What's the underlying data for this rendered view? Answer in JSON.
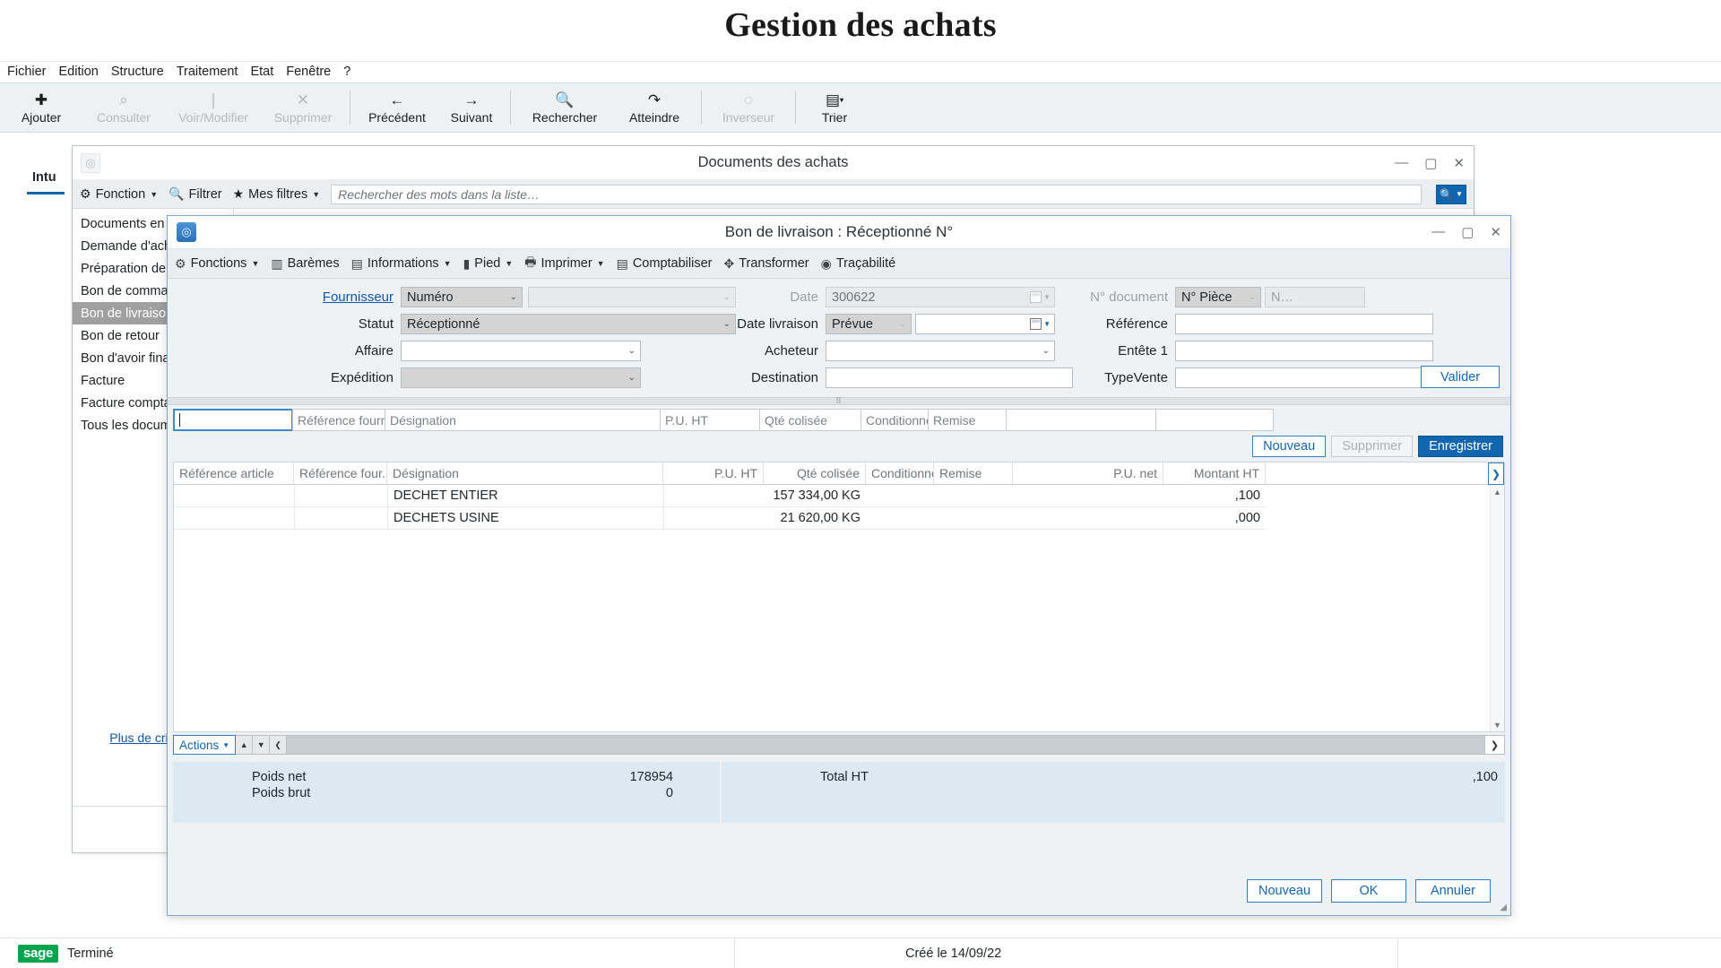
{
  "page": {
    "title": "Gestion des achats"
  },
  "menubar": {
    "items": [
      "Fichier",
      "Edition",
      "Structure",
      "Traitement",
      "Etat",
      "Fenêtre",
      "?"
    ]
  },
  "toolbar": {
    "buttons": [
      {
        "label": "Ajouter",
        "icon": "plus-icon",
        "glyph": "✚",
        "enabled": true
      },
      {
        "label": "Consulter",
        "icon": "magnifier-icon",
        "glyph": "⌕",
        "enabled": false
      },
      {
        "label": "Voir/Modifier",
        "icon": "pencil-icon",
        "glyph": "/",
        "enabled": false
      },
      {
        "label": "Supprimer",
        "icon": "cross-icon",
        "glyph": "✕",
        "enabled": false
      },
      {
        "label": "Précédent",
        "icon": "arrow-left-icon",
        "glyph": "←",
        "enabled": true
      },
      {
        "label": "Suivant",
        "icon": "arrow-right-icon",
        "glyph": "→",
        "enabled": true
      },
      {
        "label": "Rechercher",
        "icon": "search-icon",
        "glyph": "🔍",
        "enabled": true
      },
      {
        "label": "Atteindre",
        "icon": "goto-arrow-icon",
        "glyph": "⌒",
        "enabled": true
      },
      {
        "label": "Inverseur",
        "icon": "refresh-icon",
        "glyph": "◌",
        "enabled": false
      },
      {
        "label": "Trier",
        "icon": "sort-icon",
        "glyph": "▤",
        "enabled": true
      }
    ]
  },
  "background": {
    "side_label": "Intu"
  },
  "outer_window": {
    "title": "Documents des achats",
    "window_buttons": {
      "minimize": "—",
      "maximize": "▢",
      "close": "✕"
    },
    "filterbar": {
      "fonction_label": "Fonction",
      "filtrer_label": "Filtrer",
      "mesfiltres_label": "Mes filtres",
      "search_placeholder": "Rechercher des mots dans la liste…",
      "search_value": ""
    },
    "nav_items": [
      {
        "label": "Documents en cours",
        "selected": false
      },
      {
        "label": "Demande d'achat",
        "selected": false
      },
      {
        "label": "Préparation de commande",
        "selected": false
      },
      {
        "label": "Bon de commande",
        "selected": false
      },
      {
        "label": "Bon de livraison",
        "selected": true
      },
      {
        "label": "Bon de retour",
        "selected": false
      },
      {
        "label": "Bon d'avoir financier",
        "selected": false
      },
      {
        "label": "Facture",
        "selected": false
      },
      {
        "label": "Facture comptabilisée",
        "selected": false
      },
      {
        "label": "Tous les documents",
        "selected": false
      }
    ],
    "more_link": "Plus de critères"
  },
  "dialog": {
    "title": "Bon de livraison : Réceptionné N°",
    "window_buttons": {
      "minimize": "—",
      "maximize": "▢",
      "close": "✕"
    },
    "toolbar": [
      {
        "label": "Fonctions",
        "icon": "gear-icon",
        "glyph": "⚙",
        "caret": true
      },
      {
        "label": "Barèmes",
        "icon": "books-icon",
        "glyph": "▯▯",
        "caret": false
      },
      {
        "label": "Informations",
        "icon": "server-icon",
        "glyph": "▤",
        "caret": true
      },
      {
        "label": "Pied",
        "icon": "book-icon",
        "glyph": "▮",
        "caret": true
      },
      {
        "label": "Imprimer",
        "icon": "printer-icon",
        "glyph": "🖶",
        "caret": true
      },
      {
        "label": "Comptabiliser",
        "icon": "ledger-icon",
        "glyph": "▤",
        "caret": false
      },
      {
        "label": "Transformer",
        "icon": "transform-icon",
        "glyph": "✥",
        "caret": false
      },
      {
        "label": "Traçabilité",
        "icon": "traceability-icon",
        "glyph": "◉",
        "caret": false
      }
    ],
    "form": {
      "fournisseur_label": "Fournisseur",
      "fournisseur_mode": "Numéro",
      "fournisseur_value": "",
      "statut_label": "Statut",
      "statut_value": "Réceptionné",
      "affaire_label": "Affaire",
      "affaire_value": "",
      "expedition_label": "Expédition",
      "expedition_value": "",
      "date_label": "Date",
      "date_value": "300622",
      "date_livraison_label": "Date livraison",
      "date_livraison_mode": "Prévue",
      "date_livraison_value": "",
      "acheteur_label": "Acheteur",
      "acheteur_value": "",
      "destination_label": "Destination",
      "destination_value": "",
      "ndocument_label": "N° document",
      "ndocument_mode": "N° Pièce",
      "ndocument_value": "N…",
      "reference_label": "Référence",
      "reference_value": "",
      "entete1_label": "Entête 1",
      "entete1_value": "",
      "typevente_label": "TypeVente",
      "typevente_value": "",
      "valider_label": "Valider"
    },
    "entry_row": {
      "cells": [
        "",
        "Référence fournisseur",
        "Désignation",
        "P.U. HT",
        "Qté colisée",
        "Conditionnement",
        "Remise",
        "",
        ""
      ]
    },
    "row_actions": {
      "nouveau": "Nouveau",
      "supprimer": "Supprimer",
      "enregistrer": "Enregistrer"
    },
    "grid": {
      "columns": [
        "Référence article",
        "Référence four...",
        "Désignation",
        "",
        "P.U. HT",
        "Qté colisée",
        "Conditionne...",
        "Remise",
        "P.U. net",
        "Montant HT"
      ],
      "rows": [
        {
          "ref_article": "",
          "ref_four": "",
          "designation": "DECHET ENTIER",
          "pu_ht": "",
          "qte_colisee": "157 334,00 KG",
          "conditionnement": "",
          "remise": "",
          "pu_net": "",
          "montant_ht": ",100"
        },
        {
          "ref_article": "",
          "ref_four": "",
          "designation": "DECHETS USINE",
          "pu_ht": "",
          "qte_colisee": "21 620,00 KG",
          "conditionnement": "",
          "remise": "",
          "pu_net": "",
          "montant_ht": ",000"
        }
      ],
      "nav_button": "❯"
    },
    "gridnav": {
      "actions_label": "Actions",
      "up": "▲",
      "down": "▼",
      "left": "❮",
      "right": "❯"
    },
    "totals": {
      "poids_net_label": "Poids net",
      "poids_net_value": "178954",
      "poids_brut_label": "Poids brut",
      "poids_brut_value": "0",
      "total_ht_label": "Total HT",
      "total_ht_value": ",100"
    },
    "footer": {
      "nouveau": "Nouveau",
      "ok": "OK",
      "annuler": "Annuler"
    }
  },
  "statusbar": {
    "brand": "sage",
    "state": "Terminé",
    "created": "Créé le 14/09/22"
  },
  "colors": {
    "accent": "#1266b0",
    "selection": "#a0a0a0",
    "totals_panel": "#dce9f2",
    "toolbar_bg": "#eaeef1",
    "brand_green": "#00a44e"
  }
}
